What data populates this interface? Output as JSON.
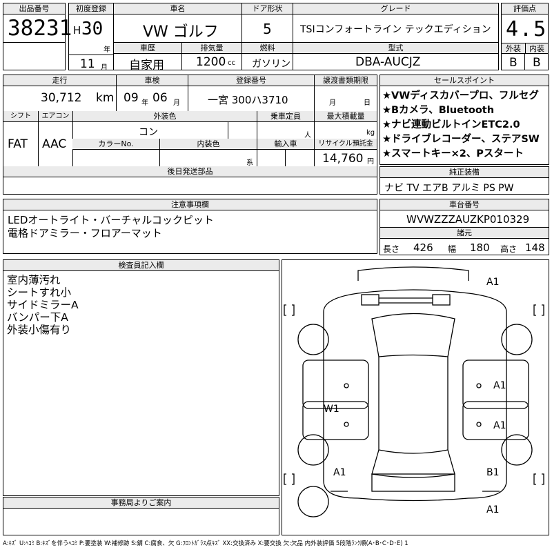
{
  "header": {
    "lot_no_label": "出品番号",
    "lot_no": "38231",
    "first_reg_label": "初度登録",
    "era": "H",
    "reg_year": "30",
    "year_unit": "年",
    "reg_month": "11",
    "month_unit": "月",
    "model_label": "車名",
    "model": "VW ゴルフ",
    "door_label": "ドア形状",
    "doors": "5",
    "grade_label": "グレード",
    "grade": "TSIコンフォートライン テックエディション",
    "score_label": "評価点",
    "score": "4.5",
    "usage_label": "車歴",
    "usage": "自家用",
    "displacement_label": "排気量",
    "displacement": "1200",
    "cc": "cc",
    "fuel_label": "燃料",
    "fuel": "ガソリン",
    "type_label": "型式",
    "type": "DBA-AUCJZ",
    "ext_label": "外装",
    "ext_grade": "B",
    "int_label": "内装",
    "int_grade": "B"
  },
  "row2": {
    "mileage_label": "走行",
    "mileage": "30,712",
    "km": "km",
    "inspection_label": "車検",
    "insp_year": "09",
    "insp_year_unit": "年",
    "insp_month": "06",
    "insp_month_unit": "月",
    "plate_label": "登録番号",
    "plate": "一宮 300ハ3710",
    "doc_label": "譲渡書類期限",
    "doc_month": "月",
    "doc_day": "日",
    "shift_label": "シフト",
    "shift": "FAT",
    "ac_label": "エアコン",
    "ac": "AAC",
    "color_label": "外装色",
    "color": "コン",
    "capacity_label": "乗車定員",
    "capacity_unit": "人",
    "load_label": "最大積載量",
    "load_unit": "kg",
    "colorno_label": "カラーNo.",
    "interior_label": "内装色",
    "interior_unit": "系",
    "import_label": "輸入車",
    "recycle_label": "リサイクル預託金",
    "recycle": "14,760",
    "yen": "円",
    "later_label": "後日発送部品"
  },
  "sales_points": {
    "label": "セールスポイント",
    "items": [
      "★VWディスカバープロ、フルセグ",
      "★Bカメラ、Bluetooth",
      "★ナビ連動ビルトインETC2.0",
      "★ドライブレコーダー、ステアSW",
      "★スマートキー×2、Pスタート"
    ]
  },
  "equipment": {
    "label": "純正装備",
    "value": "ナビ TV エアB アルミ PS PW"
  },
  "notes": {
    "label": "注意事項欄",
    "lines": [
      "LEDオートライト・バーチャルコックピット",
      "電格ドアミラー・フロアーマット"
    ]
  },
  "chassis": {
    "label": "車台番号",
    "value": "WVWZZZAUZKP010329"
  },
  "specs": {
    "label": "諸元",
    "length_label": "長さ",
    "length": "426",
    "width_label": "幅",
    "width": "180",
    "height_label": "高さ",
    "height": "148"
  },
  "inspector": {
    "label": "検査員記入欄",
    "lines": [
      "室内薄汚れ",
      "シートすれ小",
      "サイドミラーA",
      "バンパー下A",
      "外装小傷有り"
    ]
  },
  "office": {
    "label": "事務局よりご案内"
  },
  "diagram": {
    "marks": [
      "A1",
      "A1",
      "A1",
      "W1",
      "A1",
      "B1",
      "A1"
    ],
    "bracket": "[ ]"
  },
  "legend": "A:ｷｽﾞ U:ﾍｺﾐ B:ｷｽﾞを伴うﾍｺﾐ P:要塗装 W:補修跡 S:錆 C:腐食、欠 G:ﾌﾛﾝﾄｶﾞﾗｽ点ｷｽﾞ XX:交換済み X:要交換 欠:欠品 内外装評価 5段階ﾗﾝｸ順(A･B･C･D･E) 1"
}
